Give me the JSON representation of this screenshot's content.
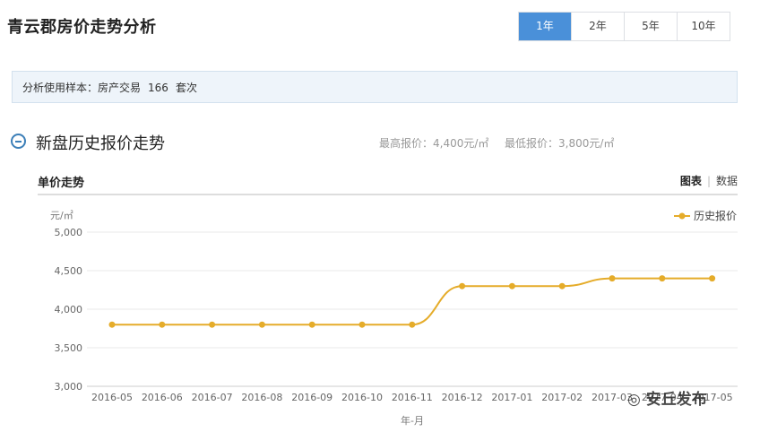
{
  "page": {
    "title": "青云郡房价走势分析",
    "range_tabs": [
      {
        "label": "1年",
        "active": true
      },
      {
        "label": "2年",
        "active": false
      },
      {
        "label": "5年",
        "active": false
      },
      {
        "label": "10年",
        "active": false
      }
    ]
  },
  "sample": {
    "label": "分析使用样本：",
    "type": "房产交易",
    "count": "166",
    "unit": "套次"
  },
  "section": {
    "title": "新盘历史报价走势",
    "max_price": "最高报价：4,400元/㎡",
    "min_price": "最低报价：3,800元/㎡"
  },
  "chart_header": {
    "title": "单价走势",
    "view_chart": "图表",
    "view_data": "数据"
  },
  "watermark": "安丘发布",
  "colors": {
    "accent": "#4a90d9",
    "series": "#e5ac2a"
  },
  "chart_data": {
    "type": "line",
    "ylabel": "元/㎡",
    "xlabel": "年-月",
    "ylim": [
      3000,
      5000
    ],
    "yticks": [
      3000,
      3500,
      4000,
      4500,
      5000
    ],
    "ytick_labels": [
      "3,000",
      "3,500",
      "4,000",
      "4,500",
      "5,000"
    ],
    "categories": [
      "2016-05",
      "2016-06",
      "2016-07",
      "2016-08",
      "2016-09",
      "2016-10",
      "2016-11",
      "2016-12",
      "2017-01",
      "2017-02",
      "2017-03",
      "2017-04",
      "2017-05"
    ],
    "series": [
      {
        "name": "历史报价",
        "values": [
          3800,
          3800,
          3800,
          3800,
          3800,
          3800,
          3800,
          4300,
          4300,
          4300,
          4400,
          4400,
          4400
        ]
      }
    ],
    "legend": "top-right",
    "grid": true
  }
}
